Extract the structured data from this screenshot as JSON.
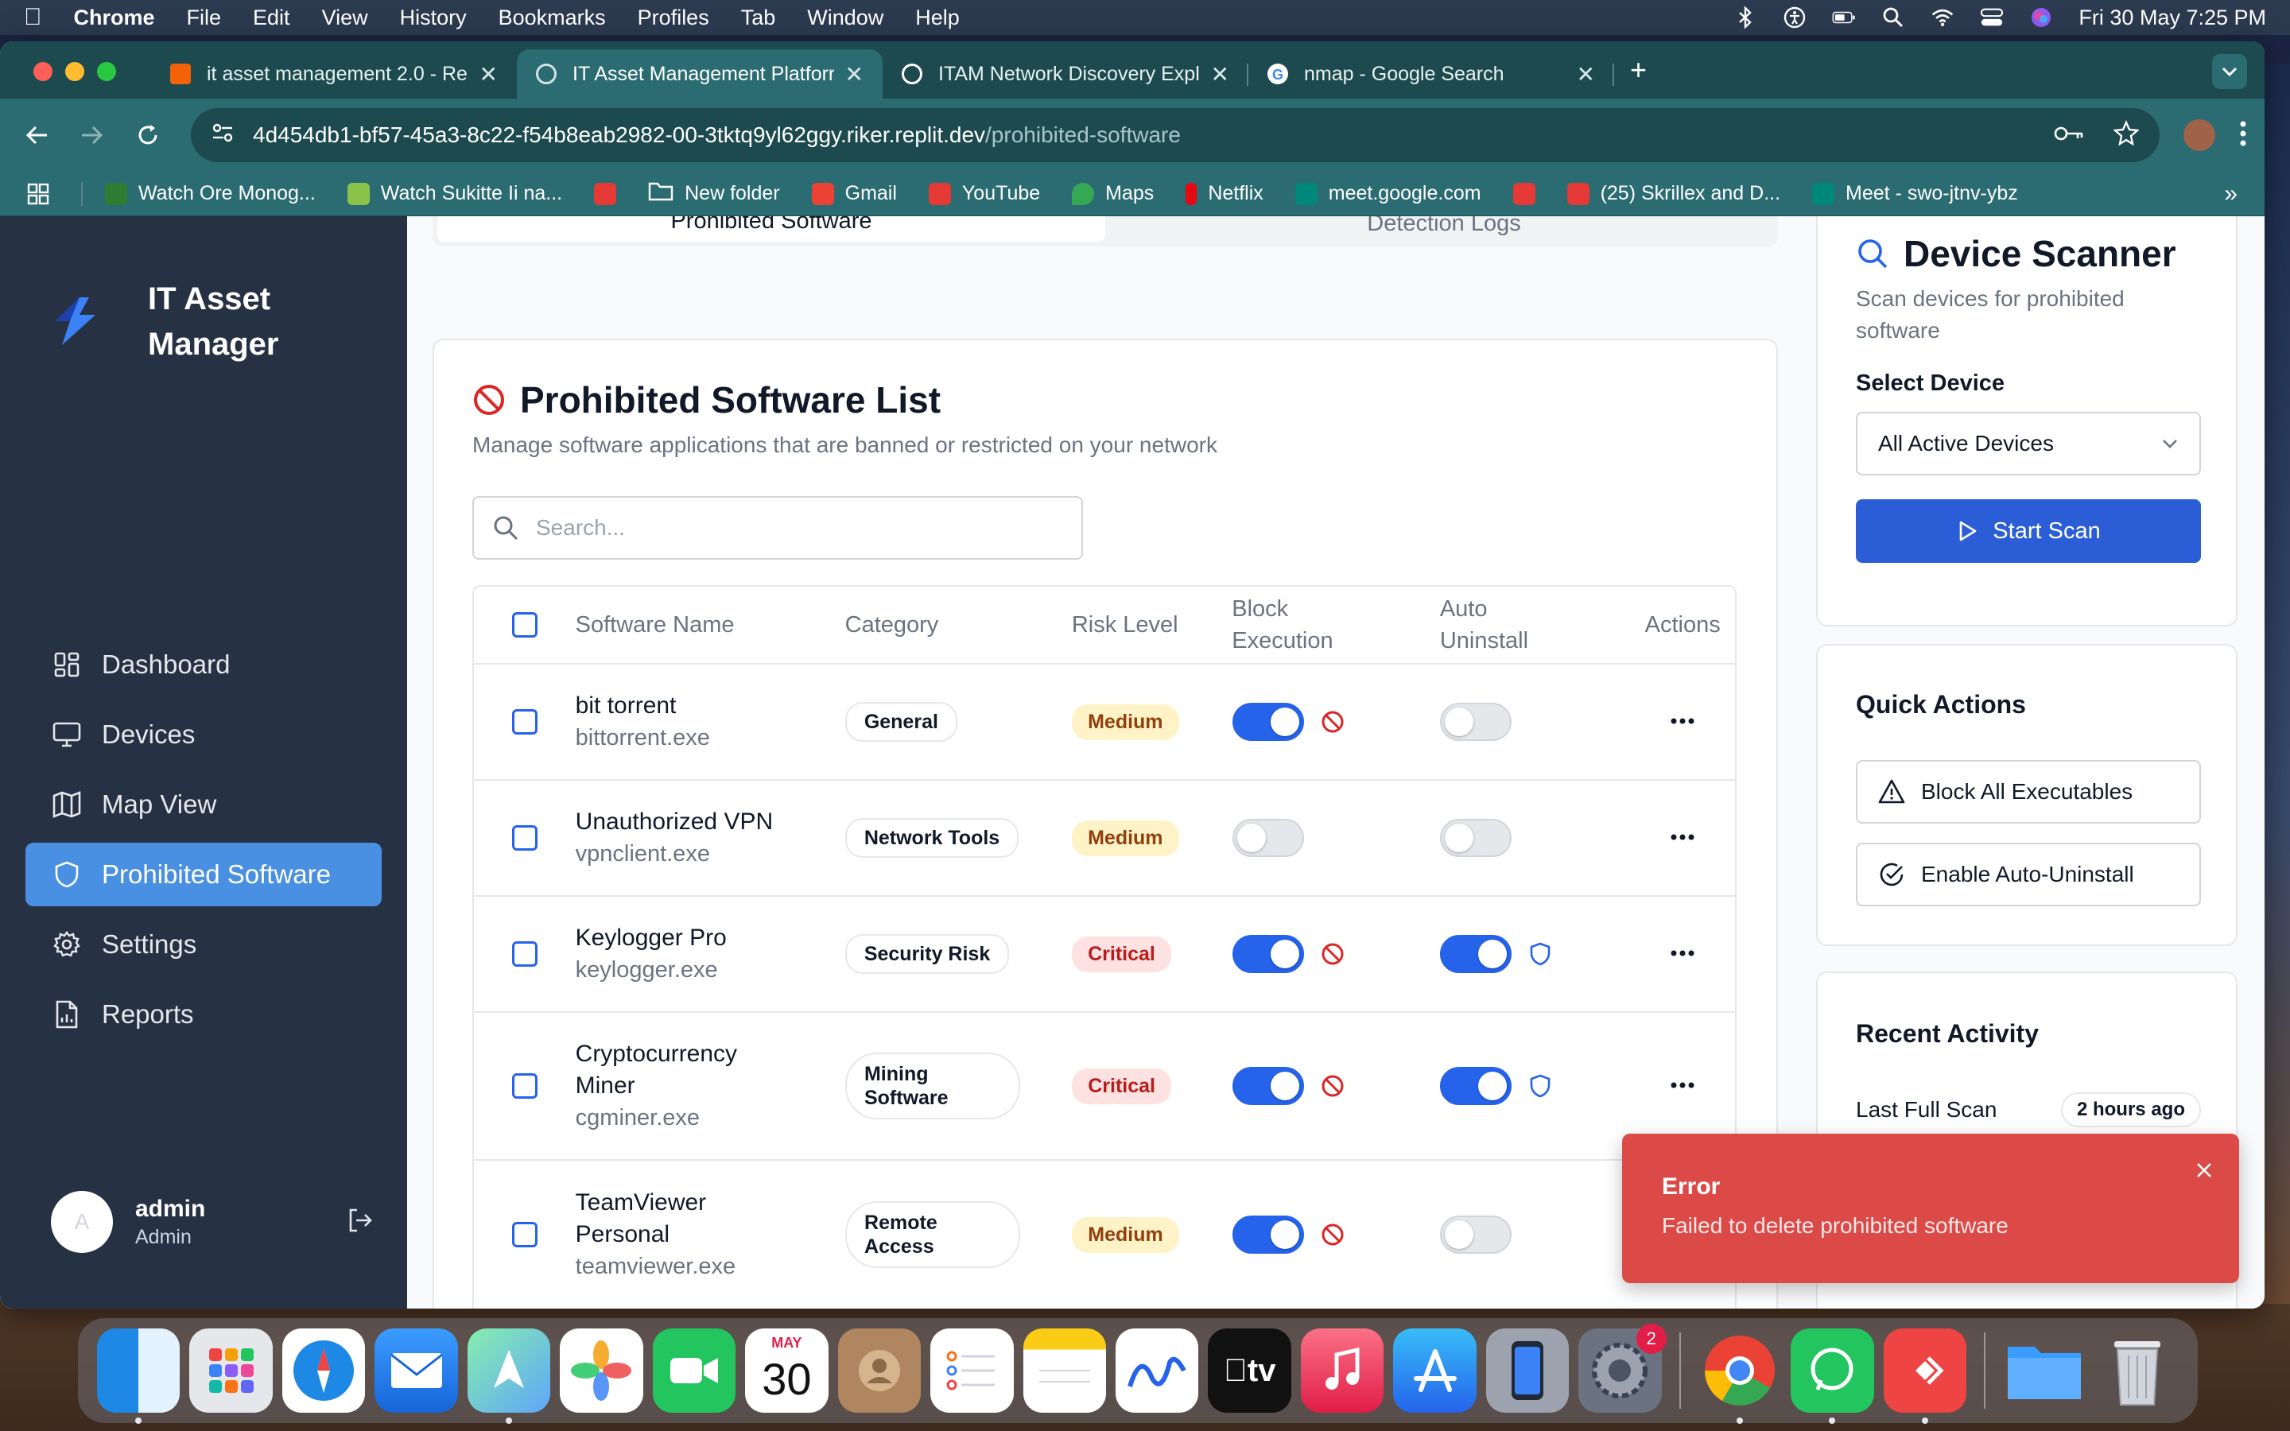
{
  "menubar": {
    "app": "Chrome",
    "items": [
      "File",
      "Edit",
      "View",
      "History",
      "Bookmarks",
      "Profiles",
      "Tab",
      "Window",
      "Help"
    ],
    "datetime": "Fri 30 May  7:25 PM"
  },
  "browser": {
    "tabs": [
      {
        "title": "it asset management 2.0 - Re",
        "favicon_color": "#f26207"
      },
      {
        "title": "IT Asset Management Platforr",
        "favicon_color": "#9fb8bb"
      },
      {
        "title": "ITAM Network Discovery Expl",
        "favicon_color": "#ffffff"
      },
      {
        "title": "nmap - Google Search",
        "favicon_color": "#4285f4"
      }
    ],
    "new_tab": "+",
    "url_host": "4d454db1-bf57-45a3-8c22-f54b8eab2982-00-3tktq9yl62ggy.riker.replit.dev",
    "url_path": "/prohibited-software",
    "bookmarks": [
      {
        "label": "Watch Ore Monog...",
        "color": "#2e7d32"
      },
      {
        "label": "Watch Sukitte Ii na...",
        "color": "#8bc34a"
      },
      {
        "label": "",
        "color": "#e53935"
      },
      {
        "label": "New folder",
        "color": "#ffffff"
      },
      {
        "label": "Gmail",
        "color": "#ea4335"
      },
      {
        "label": "YouTube",
        "color": "#e53935"
      },
      {
        "label": "Maps",
        "color": "#34a853"
      },
      {
        "label": "Netflix",
        "color": "#e50914"
      },
      {
        "label": "meet.google.com",
        "color": "#00897b"
      },
      {
        "label": "",
        "color": "#e53935"
      },
      {
        "label": "(25) Skrillex and D...",
        "color": "#e53935"
      },
      {
        "label": "Meet - swo-jtnv-ybz",
        "color": "#00897b"
      }
    ]
  },
  "sidebar": {
    "brand": "IT Asset Manager",
    "items": [
      {
        "label": "Dashboard",
        "icon": "dashboard-icon",
        "active": false
      },
      {
        "label": "Devices",
        "icon": "monitor-icon",
        "active": false
      },
      {
        "label": "Map View",
        "icon": "map-icon",
        "active": false
      },
      {
        "label": "Prohibited Software",
        "icon": "shield-icon",
        "active": true
      },
      {
        "label": "Settings",
        "icon": "gear-icon",
        "active": false
      },
      {
        "label": "Reports",
        "icon": "report-icon",
        "active": false
      }
    ],
    "user": {
      "initial": "A",
      "name": "admin",
      "role": "Admin"
    }
  },
  "page_tabs": [
    "Prohibited Software",
    "Detection Logs"
  ],
  "list": {
    "title": "Prohibited Software List",
    "subtitle": "Manage software applications that are banned or restricted on your network",
    "search_placeholder": "Search...",
    "columns": [
      "Software Name",
      "Category",
      "Risk Level",
      "Block Execution",
      "Auto Uninstall",
      "Actions"
    ],
    "rows": [
      {
        "name": "bit torrent",
        "exe": "bittorrent.exe",
        "category": "General",
        "risk": "Medium",
        "block": true,
        "auto": false
      },
      {
        "name": "Unauthorized VPN",
        "exe": "vpnclient.exe",
        "category": "Network Tools",
        "risk": "Medium",
        "block": false,
        "auto": false
      },
      {
        "name": "Keylogger Pro",
        "exe": "keylogger.exe",
        "category": "Security Risk",
        "risk": "Critical",
        "block": true,
        "auto": true
      },
      {
        "name": "Cryptocurrency Miner",
        "exe": "cgminer.exe",
        "category": "Mining Software",
        "risk": "Critical",
        "block": true,
        "auto": true
      },
      {
        "name": "TeamViewer Personal",
        "exe": "teamviewer.exe",
        "category": "Remote Access",
        "risk": "Medium",
        "block": true,
        "auto": false
      }
    ]
  },
  "scanner": {
    "title": "Device Scanner",
    "subtitle": "Scan devices for prohibited software",
    "select_label": "Select Device",
    "select_value": "All Active Devices",
    "button": "Start Scan"
  },
  "quick_actions": {
    "title": "Quick Actions",
    "block_all": "Block All Executables",
    "enable_auto": "Enable Auto-Uninstall"
  },
  "recent_activity": {
    "title": "Recent Activity",
    "last_scan_label": "Last Full Scan",
    "last_scan_value": "2 hours ago"
  },
  "toast": {
    "title": "Error",
    "message": "Failed to delete prohibited software"
  },
  "dock": {
    "calendar_month": "MAY",
    "calendar_day": "30",
    "settings_badge": "2"
  },
  "colors": {
    "sidebar_bg": "#263244",
    "active_nav": "#4a90e2",
    "primary": "#2563eb",
    "error": "#dc4a47"
  }
}
